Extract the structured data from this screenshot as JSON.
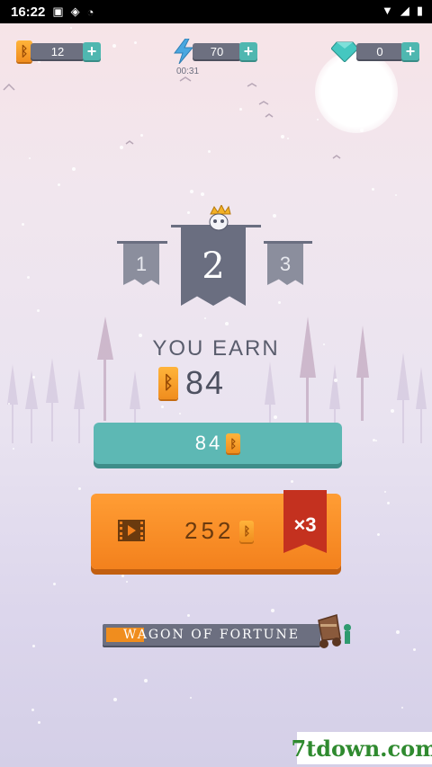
{
  "status_bar": {
    "time": "16:22"
  },
  "resources": {
    "runes": {
      "icon": "rune-icon",
      "rune_glyph": "ᛒ",
      "count": "12"
    },
    "energy": {
      "icon": "lightning-icon",
      "count": "70",
      "timer": "00:31"
    },
    "gems": {
      "icon": "diamond-icon",
      "count": "0"
    },
    "plus": "+"
  },
  "ranks": {
    "left": "1",
    "center": "2",
    "right": "3"
  },
  "earn": {
    "title": "YOU EARN",
    "value": "84"
  },
  "collect_button": {
    "value": "84"
  },
  "ad_button": {
    "value": "252",
    "multiplier": "×3"
  },
  "wagon": {
    "label": "WAGON OF FORTUNE",
    "progress": 0.18
  },
  "watermark": "7tdown.com",
  "colors": {
    "accent_orange": "#f3811d",
    "teal": "#5db8b4",
    "banner": "#6a6e80"
  }
}
